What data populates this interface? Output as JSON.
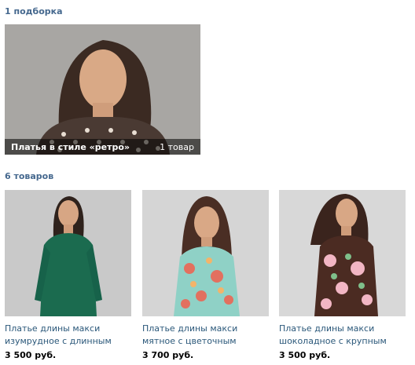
{
  "collections": {
    "header": "1 подборка",
    "items": [
      {
        "title": "Платья в стиле «ретро»",
        "count": "1 товар"
      }
    ]
  },
  "products": {
    "header": "6 товаров",
    "items": [
      {
        "title": "Платье длины макси изумрудное с длинным рукавом",
        "price": "3 500 руб.",
        "dress_color": "#1b6b4f",
        "bg_color": "#c9c9c9"
      },
      {
        "title": "Платье длины макси мятное с цветочным принтом",
        "price": "3 700 руб.",
        "dress_color": "#8fd1c6",
        "bg_color": "#d5d5d5"
      },
      {
        "title": "Платье длины макси шоколадное с крупным цветочным принтом",
        "price": "3 500 руб.",
        "dress_color": "#4b2b22",
        "bg_color": "#d8d8d8"
      }
    ]
  },
  "colors": {
    "link": "#2b587a",
    "section": "#45688e"
  }
}
